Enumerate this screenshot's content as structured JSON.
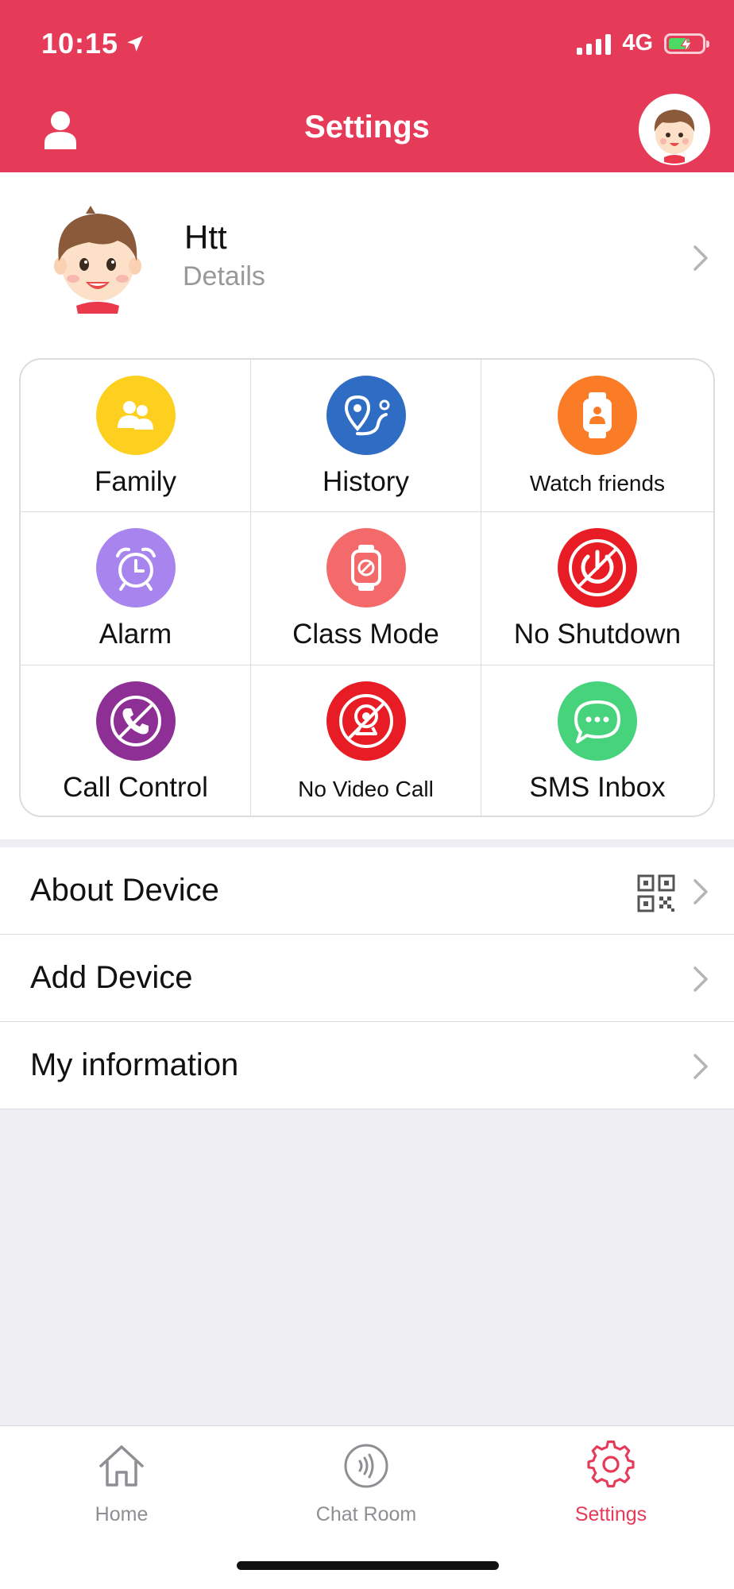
{
  "status_bar": {
    "time": "10:15",
    "network": "4G"
  },
  "header": {
    "title": "Settings"
  },
  "profile": {
    "name": "Htt",
    "subtitle": "Details"
  },
  "grid": {
    "items": [
      {
        "label": "Family",
        "icon": "family-icon",
        "color": "#fdd020"
      },
      {
        "label": "History",
        "icon": "location-history-icon",
        "color": "#2f6cc4"
      },
      {
        "label": "Watch friends",
        "icon": "watch-friends-icon",
        "color": "#fb7c27"
      },
      {
        "label": "Alarm",
        "icon": "alarm-clock-icon",
        "color": "#a885ee"
      },
      {
        "label": "Class Mode",
        "icon": "class-mode-watch-icon",
        "color": "#f46a6a"
      },
      {
        "label": "No Shutdown",
        "icon": "no-shutdown-icon",
        "color": "#e81c24"
      },
      {
        "label": "Call Control",
        "icon": "call-control-icon",
        "color": "#8d2f94"
      },
      {
        "label": "No Video Call",
        "icon": "no-video-call-icon",
        "color": "#e81c24"
      },
      {
        "label": "SMS Inbox",
        "icon": "sms-inbox-icon",
        "color": "#46d37c"
      }
    ]
  },
  "list": {
    "items": [
      {
        "label": "About Device"
      },
      {
        "label": "Add Device"
      },
      {
        "label": "My information"
      }
    ]
  },
  "tabbar": {
    "tabs": [
      {
        "label": "Home",
        "icon": "home-icon"
      },
      {
        "label": "Chat Room",
        "icon": "chat-room-icon"
      },
      {
        "label": "Settings",
        "icon": "gear-icon"
      }
    ],
    "active_color": "#e63a59"
  },
  "colors": {
    "accent": "#e63a59",
    "inactive": "#8e8e93",
    "background": "#eeeef3"
  }
}
